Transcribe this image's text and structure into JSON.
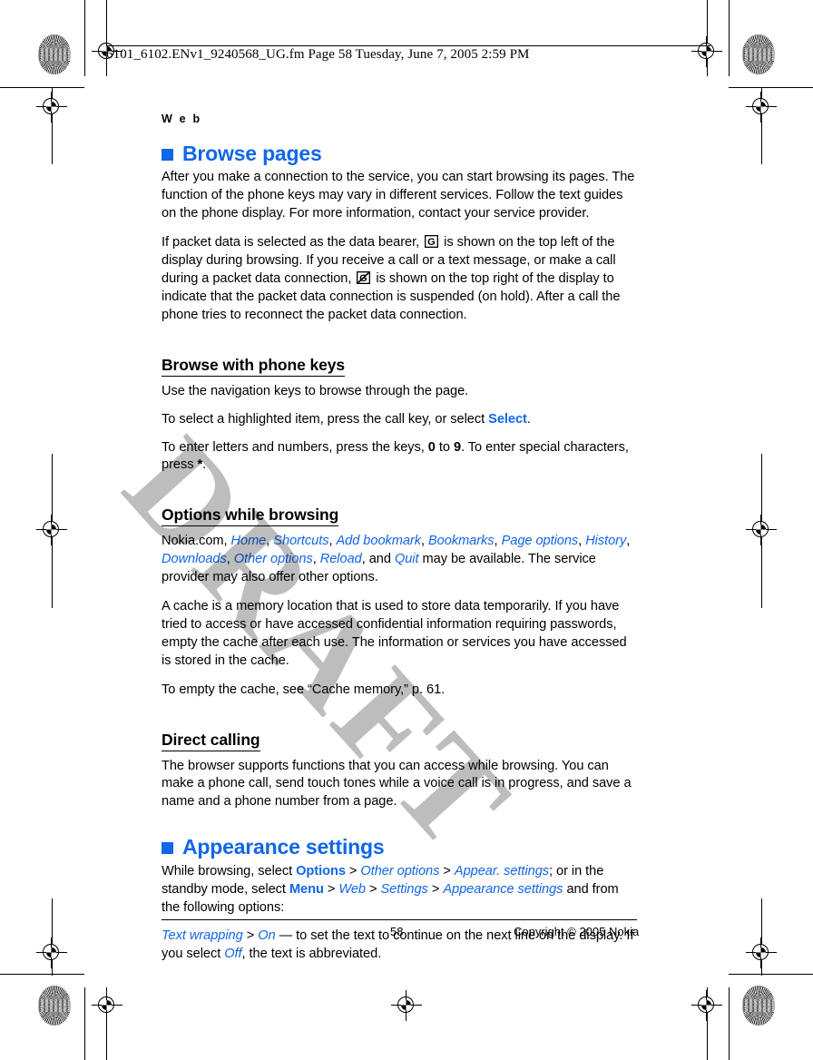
{
  "prepress": {
    "filemaker_header": "6101_6102.ENv1_9240568_UG.fm  Page 58  Tuesday, June 7, 2005  2:59 PM"
  },
  "running_head": "W e b",
  "sections": [
    {
      "id": "browse-pages",
      "heading": "Browse pages",
      "level": "section"
    },
    {
      "id": "appearance-settings",
      "heading": "Appearance settings",
      "level": "section"
    }
  ],
  "headings": {
    "browse_pages": "Browse pages",
    "browse_with_phone_keys": "Browse with phone keys",
    "options_while_browsing": "Options while browsing",
    "direct_calling": "Direct calling",
    "appearance_settings": "Appearance settings"
  },
  "paragraphs": {
    "intro": "After you make a connection to the service, you can start browsing its pages. The function of the phone keys may vary in different services. Follow the text guides on the phone display. For more information, contact your service provider.",
    "packet_p1": "If packet data is selected as the data bearer,",
    "packet_p2": "is shown on the top left of the display during browsing. If you receive a call or a text message, or make a call during a packet data connection,",
    "packet_p3": "is shown on the top right of the display to indicate that the packet data connection is suspended (on hold). After a call the phone tries to reconnect the packet data connection.",
    "nav_keys": "Use the navigation keys to browse through the page.",
    "select_pre": "To select a highlighted item, press the call key, or select",
    "select_label": "Select",
    "select_post": ".",
    "letters_pre": "To enter letters and numbers, press the keys,",
    "key_zero": "0",
    "letters_mid": "to",
    "key_nine": "9",
    "letters_post": ". To enter special characters, press",
    "key_star": "*",
    "letters_end": ".",
    "options_intro_pre": "Nokia.com,",
    "options_intro_post": "may be available. The service provider may also offer other options.",
    "options_and": ", and",
    "cache_info": "A cache is a memory location that is used to store data temporarily. If you have tried to access or have accessed confidential information requiring passwords, empty the cache after each use. The information or services you have accessed is stored in the cache.",
    "cache_ref": "To empty the cache, see “Cache memory,” p. 61.",
    "direct_calling_body": "The browser supports functions that you can access while browsing. You can make a phone call, send touch tones while a voice call is in progress, and save a name and a phone number from a page.",
    "appearance_pre": "While browsing, select",
    "appearance_mid1": "; or in the standby mode, select",
    "appearance_mid2": "and from the following options:",
    "text_wrapping_desc": "— to set the text to continue on the next line on the display. If you select",
    "text_wrapping_end": ", the text is abbreviated."
  },
  "menu_items": {
    "options": "Options",
    "other_options": "Other options",
    "appear_settings": "Appear. settings",
    "menu": "Menu",
    "web": "Web",
    "settings": "Settings",
    "appearance_settings": "Appearance settings",
    "text_wrapping": "Text wrapping",
    "on": "On",
    "off": "Off",
    "separator": ">"
  },
  "browse_options": [
    "Home",
    "Shortcuts",
    "Add bookmark",
    "Bookmarks",
    "Page options",
    "History",
    "Downloads",
    "Other options",
    "Reload",
    "Quit"
  ],
  "icons": {
    "gprs_active": "gprs-indicator-icon",
    "gprs_suspended": "gprs-suspended-icon"
  },
  "watermark": "DRAFT",
  "footer": {
    "page_number": "58",
    "copyright": "Copyright © 2005 Nokia"
  },
  "colors": {
    "accent_blue": "#1166e8",
    "text_black": "#000000",
    "watermark_gray": "rgba(0,0,0,0.26)"
  }
}
